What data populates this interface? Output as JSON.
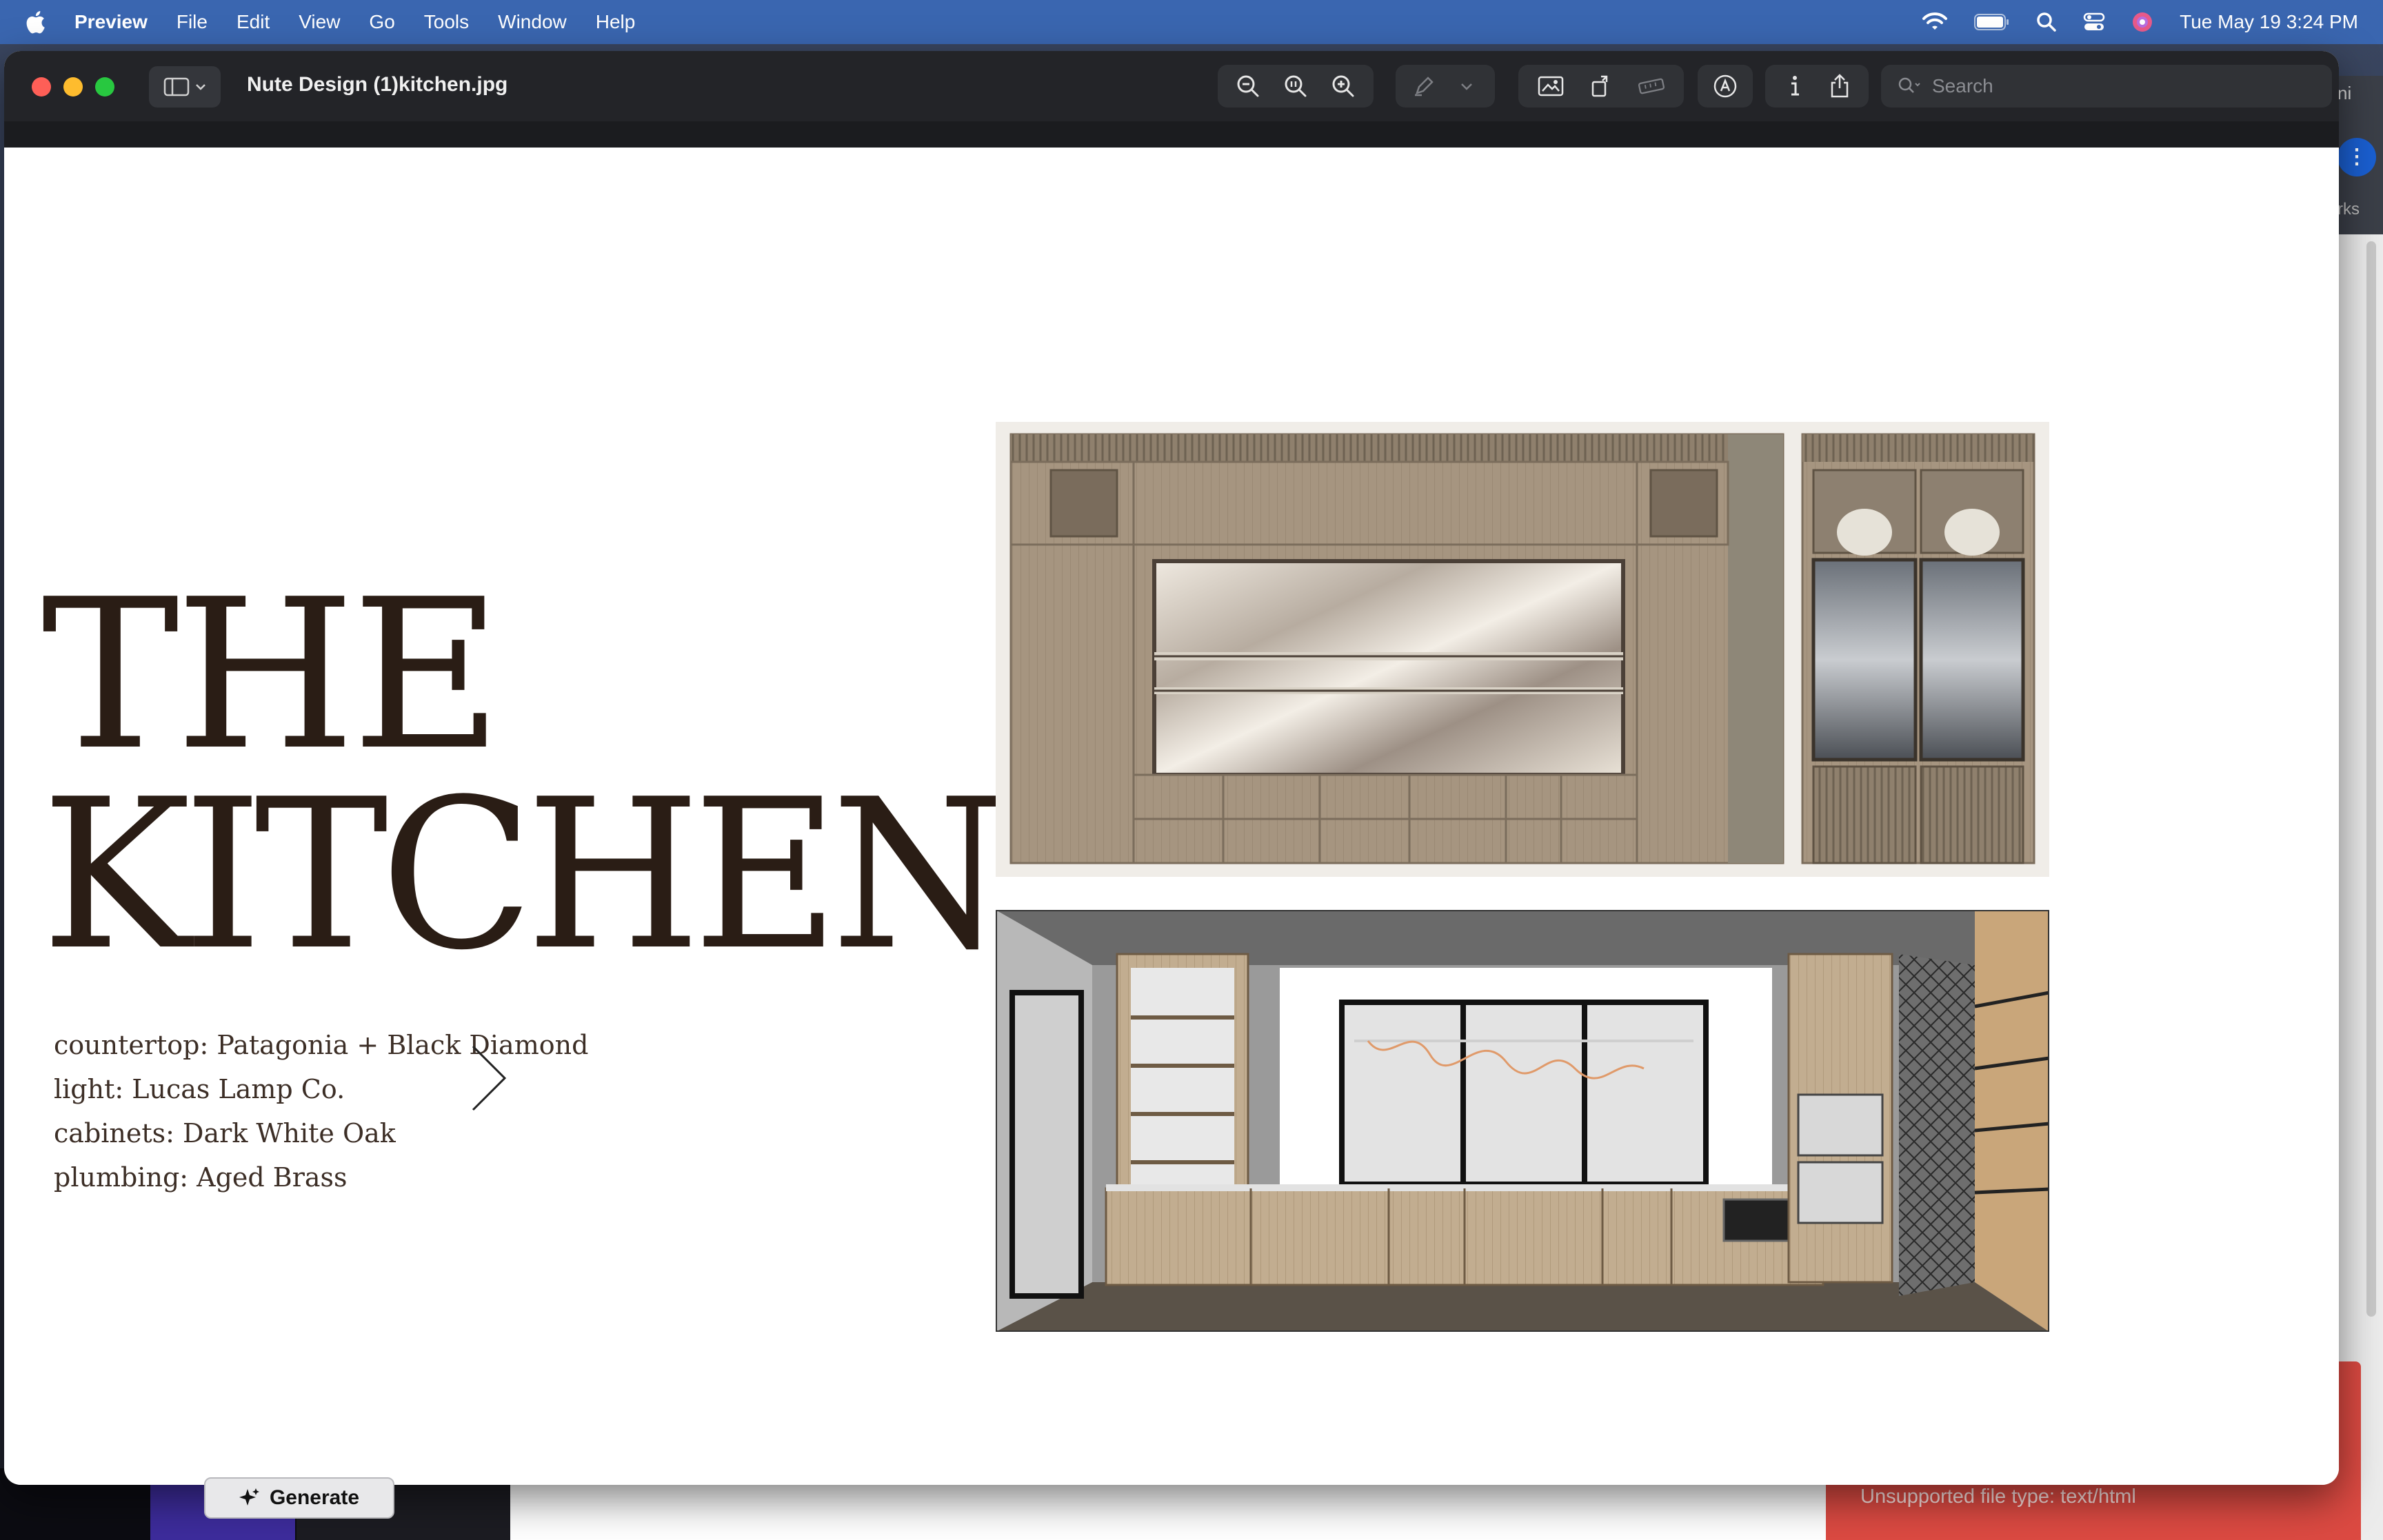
{
  "menubar": {
    "app_name": "Preview",
    "items": [
      "File",
      "Edit",
      "View",
      "Go",
      "Tools",
      "Window",
      "Help"
    ],
    "clock": "Tue May 19  3:24 PM"
  },
  "window": {
    "title": "Nute Design (1)kitchen.jpg",
    "search_placeholder": "Search"
  },
  "document": {
    "heading_line1": "THE",
    "heading_line2": "KITCHEN",
    "specs": [
      "countertop: Patagonia + Black Diamond",
      "light: Lucas Lamp Co.",
      "cabinets: Dark White Oak",
      "plumbing: Aged Brass"
    ]
  },
  "background": {
    "generate_label": "Generate",
    "error_message": "Unsupported file type: text/html",
    "right_tab_text": "ni",
    "right_tab_subtext": "rks"
  },
  "colors": {
    "menubar": "#3a66b0",
    "heading": "#2a1d15",
    "error_panel": "#dc4a42"
  }
}
